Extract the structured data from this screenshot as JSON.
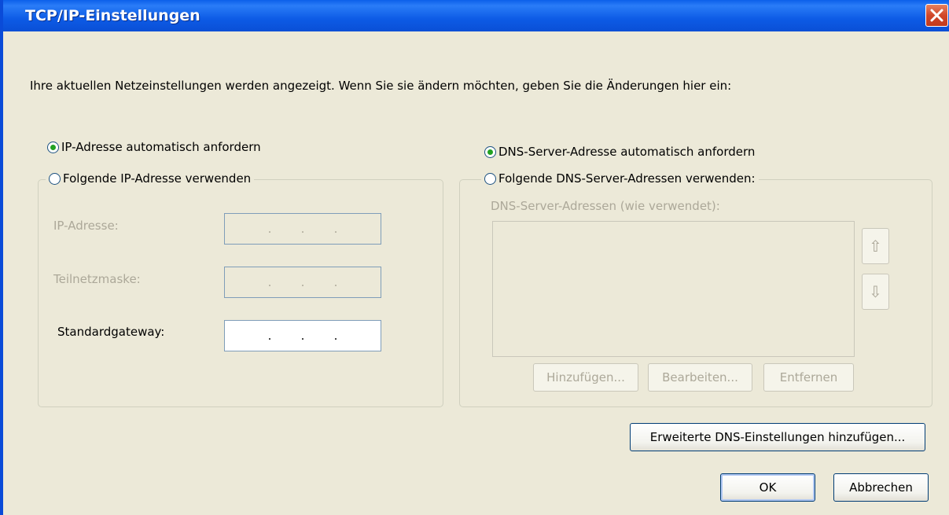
{
  "window": {
    "title": "TCP/IP-Einstellungen"
  },
  "intro": "Ihre aktuellen Netzeinstellungen werden angezeigt. Wenn Sie sie ändern möchten, geben Sie die Änderungen hier ein:",
  "ip": {
    "auto_label": "IP-Adresse automatisch anfordern",
    "manual_label": "Folgende IP-Adresse verwenden",
    "selected": "auto",
    "ip_address_label": "IP-Adresse:",
    "subnet_label": "Teilnetzmaske:",
    "gateway_label": "Standardgateway:",
    "dot": "."
  },
  "dns": {
    "auto_label": "DNS-Server-Adresse automatisch anfordern",
    "manual_label": "Folgende DNS-Server-Adressen verwenden:",
    "selected": "auto",
    "list_label": "DNS-Server-Adressen (wie verwendet):",
    "up_glyph": "⇧",
    "down_glyph": "⇩",
    "add_button": "Hinzufügen...",
    "edit_button": "Bearbeiten...",
    "remove_button": "Entfernen"
  },
  "buttons": {
    "advanced_dns": "Erweiterte DNS-Einstellungen hinzufügen...",
    "ok": "OK",
    "cancel": "Abbrechen"
  },
  "colors": {
    "titlebar": "#0A4FD6",
    "face": "#ECE9D8",
    "radio_dot": "#21A121",
    "disabled_text": "#ACA899"
  }
}
